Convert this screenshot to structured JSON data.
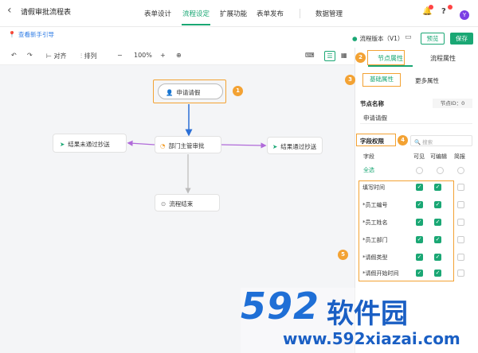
{
  "header": {
    "back_icon": "chevron-left-icon",
    "title": "请假审批流程表",
    "tabs": [
      "表单设计",
      "流程设定",
      "扩展功能",
      "表单发布"
    ],
    "active_tab": "流程设定",
    "data_mgmt": "数据管理",
    "avatar_letter": "Y"
  },
  "subbar": {
    "guide": "查看新手引导",
    "version": "流程版本（V1）",
    "preview": "预览",
    "save": "保存"
  },
  "toolbar": {
    "align": "对齐",
    "arrange": "排列",
    "zoom": "100%",
    "minus": "−",
    "plus": "+"
  },
  "flow": {
    "start": "申请请假",
    "manager": "部门主管审批",
    "reject": "结果未通过抄送",
    "pass": "结果通过抄送",
    "end": "流程结束"
  },
  "callouts": [
    "1",
    "2",
    "3",
    "4",
    "5"
  ],
  "panel": {
    "tab_node": "节点属性",
    "tab_flow": "流程属性",
    "sub_basic": "基础属性",
    "sub_more": "更多属性",
    "node_name_label": "节点名称",
    "node_id": "节点ID：0",
    "node_name_value": "申请请假",
    "perm_label": "字段权限",
    "search_placeholder": "搜索",
    "col_field": "字段",
    "col_visible": "可见",
    "col_editable": "可编辑",
    "col_brief": "简报",
    "select_all": "全选",
    "fields": [
      "填写时间",
      "员工编号",
      "员工姓名",
      "员工部门",
      "请假类型",
      "请假开始时间"
    ]
  },
  "watermark": {
    "number": "592",
    "brand": "软件园",
    "url": "www.592xiazai.com"
  },
  "colors": {
    "accent": "#1aa774",
    "callout": "#f3a233",
    "connector_main": "#2c6fd6",
    "connector_side": "#b06ad9"
  }
}
